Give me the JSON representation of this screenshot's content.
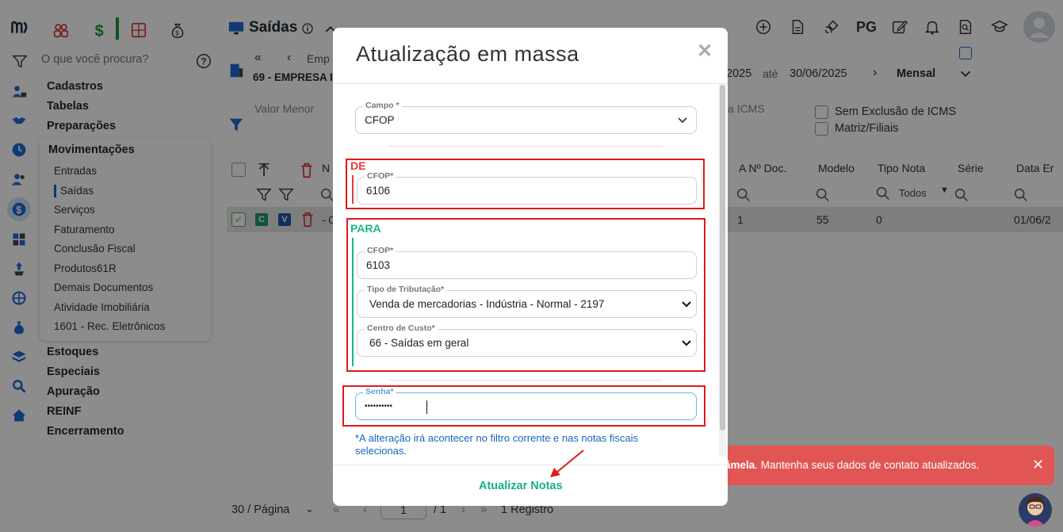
{
  "app": {
    "page_title": "Saídas",
    "search_placeholder": "O que você procura?",
    "pg_label": "PG"
  },
  "menu": {
    "categories_top": [
      "Cadastros",
      "Tabelas",
      "Preparações"
    ],
    "open_group": {
      "title": "Movimentações",
      "items": [
        "Entradas",
        "Saídas",
        "Serviços",
        "Faturamento",
        "Conclusão Fiscal",
        "Produtos61R",
        "Demais Documentos",
        "Atividade Imobiliária",
        "1601 - Rec. Eletrônicos"
      ],
      "active_item": "Saídas"
    },
    "categories_bottom": [
      "Estoques",
      "Especiais",
      "Apuração",
      "REINF",
      "Encerramento"
    ]
  },
  "header": {
    "company_short": "Emp",
    "company": "69 - EMPRESA I",
    "date_from_suffix": "2025",
    "date_sep": "até",
    "date_to": "30/06/2025",
    "period": "Mensal"
  },
  "filters": {
    "valor_menor": "Valor Menor",
    "icms_partial": "a ICMS",
    "sem_exclusao": "Sem Exclusão de ICMS",
    "matriz_filiais": "Matriz/Filiais"
  },
  "table": {
    "headers": {
      "n": "N",
      "a_n_doc": "A Nº Doc.",
      "modelo": "Modelo",
      "tipo_nota": "Tipo Nota",
      "serie": "Série",
      "data_em": "Data Er"
    },
    "tipo_nota_filter": "Todos",
    "row": {
      "c": "C",
      "v": "V",
      "dash": "- 0",
      "a_n_doc": "1",
      "modelo": "55",
      "tipo_nota": "0",
      "data": "01/06/2"
    }
  },
  "pagination": {
    "per_page": "30 / Página",
    "current": "1",
    "total": "/ 1",
    "count": "1 Registro"
  },
  "toast": {
    "name_fragment": "âmela",
    "message": ". Mantenha seus dados de contato atualizados."
  },
  "modal": {
    "title": "Atualização em massa",
    "campo": {
      "label": "Campo *",
      "value": "CFOP"
    },
    "de": {
      "section_label": "DE",
      "cfop": {
        "label": "CFOP*",
        "value": "6106"
      }
    },
    "para": {
      "section_label": "PARA",
      "cfop": {
        "label": "CFOP*",
        "value": "6103"
      },
      "tipo_tributacao": {
        "label": "Tipo de Tributação*",
        "value": "Venda de mercadorias - Indústria - Normal - 2197"
      },
      "centro_custo": {
        "label": "Centro de Custo*",
        "value": "66 - Saídas em geral"
      }
    },
    "senha": {
      "label": "Senha*",
      "value": "••••••••••"
    },
    "note": "*A alteração irá acontecer no filtro corrente e nas notas fiscais selecionas.",
    "submit_label": "Atualizar Notas"
  },
  "colors": {
    "accent_green": "#16b08a",
    "accent_blue": "#1565c0",
    "highlight_red": "#e01919",
    "de_label_red": "#e53935",
    "para_label_green": "#18b888"
  },
  "icons": [
    "logo-icon",
    "users-icon",
    "dollar-icon",
    "calculator-icon",
    "money-bag-icon",
    "monitor-icon",
    "info-icon",
    "chevron-up-icon",
    "add-circle-icon",
    "document-icon",
    "satellite-icon",
    "edit-icon",
    "bell-icon",
    "search-doc-icon",
    "graduation-icon",
    "avatar-icon",
    "filter-icon",
    "help-icon",
    "close-icon",
    "chevron-down-icon"
  ]
}
